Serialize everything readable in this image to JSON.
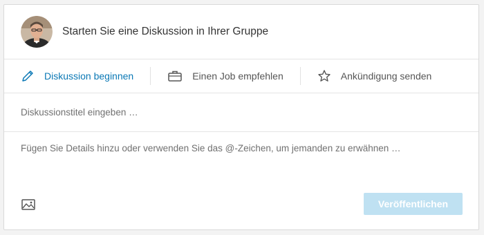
{
  "composer": {
    "title": "Starten Sie eine Diskussion in Ihrer Gruppe",
    "avatar_icon": "user-avatar-photo"
  },
  "actions": [
    {
      "label": "Diskussion beginnen",
      "icon": "pencil-icon",
      "active": true
    },
    {
      "label": "Einen Job empfehlen",
      "icon": "briefcase-icon",
      "active": false
    },
    {
      "label": "Ankündigung senden",
      "icon": "star-icon",
      "active": false
    }
  ],
  "title_input": {
    "placeholder": "Diskussionstitel eingeben …",
    "value": ""
  },
  "details_input": {
    "placeholder": "Fügen Sie Details hinzu oder verwenden Sie das @-Zeichen, um jemanden zu erwähnen …",
    "value": ""
  },
  "footer": {
    "image_icon": "image-icon",
    "publish_label": "Veröffentlichen"
  },
  "colors": {
    "accent": "#0a78b5",
    "publish_disabled_bg": "#bfe1f2"
  }
}
